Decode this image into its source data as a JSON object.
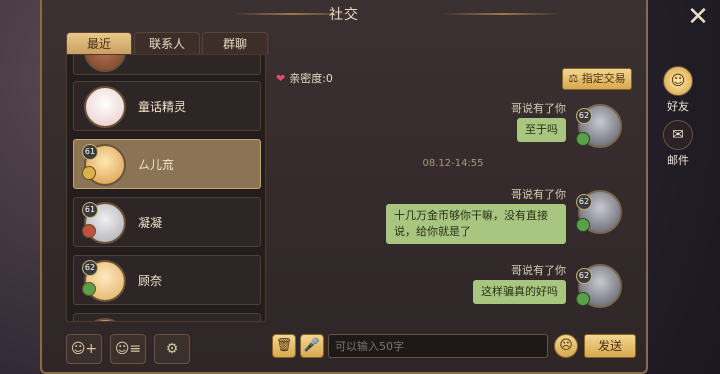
{
  "window": {
    "title": "社交"
  },
  "tabs": [
    {
      "label": "最近",
      "active": true
    },
    {
      "label": "联系人",
      "active": false
    },
    {
      "label": "群聊",
      "active": false
    }
  ],
  "friends": [
    {
      "name": "童话精灵",
      "level": "",
      "selected": false
    },
    {
      "name": "ㄙ儿㐬",
      "level": "61",
      "selected": true
    },
    {
      "name": "凝凝",
      "level": "61",
      "selected": false
    },
    {
      "name": "顾奈",
      "level": "62",
      "selected": false
    }
  ],
  "chat": {
    "intimacy": "亲密度:0",
    "trade_button": "指定交易",
    "timestamp": "08.12-14:55",
    "messages": [
      {
        "sender": "哥说有了你",
        "text": "至于吗",
        "level": "62"
      },
      {
        "sender": "哥说有了你",
        "text": "十几万金币够你干嘛，没有直接说，给你就是了",
        "level": "62"
      },
      {
        "sender": "哥说有了你",
        "text": "这样骗真的好吗",
        "level": "62"
      }
    ]
  },
  "input": {
    "placeholder": "可以输入50字"
  },
  "send_button": "发送",
  "side": {
    "friends_label": "好友",
    "mail_label": "邮件"
  },
  "colors": {
    "accent": "#d7a94e",
    "bubble": "#a8c680",
    "panel": "#2f2628"
  },
  "icons": {
    "close": "close-icon",
    "add_friend": "add-friend-icon",
    "friend_list": "friend-list-icon",
    "settings": "gear-icon",
    "trash": "trash-icon",
    "voice": "microphone-icon",
    "emoji": "emoji-icon",
    "heart": "heart-icon",
    "trade": "scale-icon"
  }
}
